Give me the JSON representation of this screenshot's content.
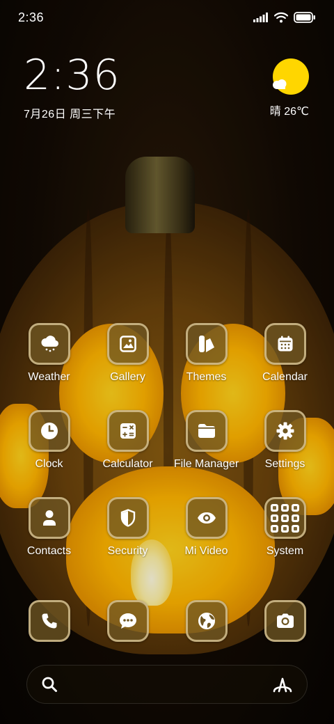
{
  "status_bar": {
    "time": "2:36",
    "icons": [
      "signal-icon",
      "wifi-icon",
      "battery-icon"
    ]
  },
  "clock_widget": {
    "time": "2:36",
    "date": "7月26日 周三下午"
  },
  "weather_widget": {
    "condition_icon": "sun-cloud-icon",
    "text": "晴 26℃"
  },
  "apps": [
    {
      "label": "Weather",
      "icon": "weather-cloud-icon"
    },
    {
      "label": "Gallery",
      "icon": "gallery-icon"
    },
    {
      "label": "Themes",
      "icon": "themes-icon"
    },
    {
      "label": "Calendar",
      "icon": "calendar-icon"
    },
    {
      "label": "Clock",
      "icon": "clock-icon"
    },
    {
      "label": "Calculator",
      "icon": "calculator-icon"
    },
    {
      "label": "File Manager",
      "icon": "folder-icon"
    },
    {
      "label": "Settings",
      "icon": "gear-icon"
    },
    {
      "label": "Contacts",
      "icon": "contact-person-icon"
    },
    {
      "label": "Security",
      "icon": "shield-icon"
    },
    {
      "label": "Mi Video",
      "icon": "video-eye-icon"
    },
    {
      "label": "System",
      "icon": "folder-grid-icon"
    }
  ],
  "dock": [
    {
      "icon": "phone-icon"
    },
    {
      "icon": "message-icon"
    },
    {
      "icon": "browser-globe-icon"
    },
    {
      "icon": "camera-icon"
    }
  ],
  "search_bar": {
    "left_icon": "search-icon",
    "right_icon": "assistant-icon"
  },
  "colors": {
    "icon_fill": "#6e5622",
    "icon_border": "#e1cda0",
    "sun": "#ffd600",
    "glow": "#ffb400"
  }
}
